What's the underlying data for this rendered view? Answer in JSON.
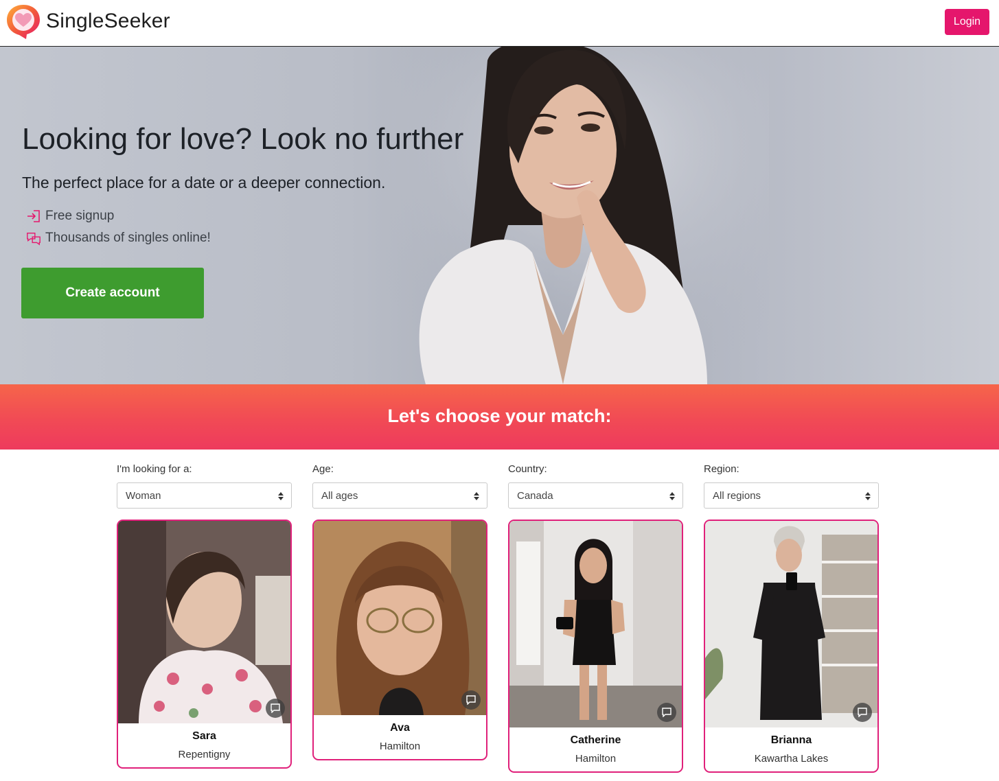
{
  "header": {
    "brand": "SingleSeeker",
    "login_label": "Login"
  },
  "hero": {
    "title": "Looking for love? Look no further",
    "subtitle": "The perfect place for a date or a deeper connection.",
    "features": [
      {
        "icon": "sign-in-icon",
        "label": "Free signup"
      },
      {
        "icon": "chat-bubbles-icon",
        "label": "Thousands of singles online!"
      }
    ],
    "cta_label": "Create account"
  },
  "match": {
    "title": "Let's choose your match:"
  },
  "filters": [
    {
      "label": "I'm looking for a:",
      "value": "Woman"
    },
    {
      "label": "Age:",
      "value": "All ages"
    },
    {
      "label": "Country:",
      "value": "Canada"
    },
    {
      "label": "Region:",
      "value": "All regions"
    }
  ],
  "profiles": [
    {
      "name": "Sara",
      "city": "Repentigny"
    },
    {
      "name": "Ava",
      "city": "Hamilton"
    },
    {
      "name": "Catherine",
      "city": "Hamilton"
    },
    {
      "name": "Brianna",
      "city": "Kawartha Lakes"
    }
  ],
  "colors": {
    "brand_pink": "#e5166c",
    "cta_green": "#3e9c2f",
    "banner_top": "#f6654a",
    "banner_bottom": "#ee3a5d",
    "card_border": "#e0207a"
  }
}
